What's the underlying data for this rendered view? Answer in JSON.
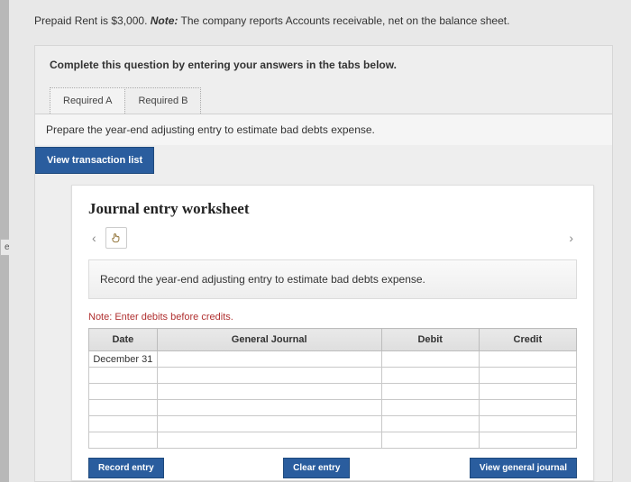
{
  "side_tab": "es",
  "intro": {
    "prefix": "Prepaid Rent is $3,000. ",
    "note_label": "Note:",
    "note_text": " The company reports Accounts receivable, net on the balance sheet."
  },
  "tabs_box": {
    "header": "Complete this question by entering your answers in the tabs below.",
    "tabs": [
      {
        "label": "Required A"
      },
      {
        "label": "Required B"
      }
    ],
    "prepare_text": "Prepare the year-end adjusting entry to estimate bad debts expense.",
    "view_txn": "View transaction list"
  },
  "worksheet": {
    "title": "Journal entry worksheet",
    "record_instruction": "Record the year-end adjusting entry to estimate bad debts expense.",
    "note": "Note: Enter debits before credits.",
    "columns": {
      "date": "Date",
      "gj": "General Journal",
      "debit": "Debit",
      "credit": "Credit"
    },
    "date_value": "December 31",
    "actions": {
      "record": "Record entry",
      "clear": "Clear entry",
      "view_gj": "View general journal"
    }
  }
}
